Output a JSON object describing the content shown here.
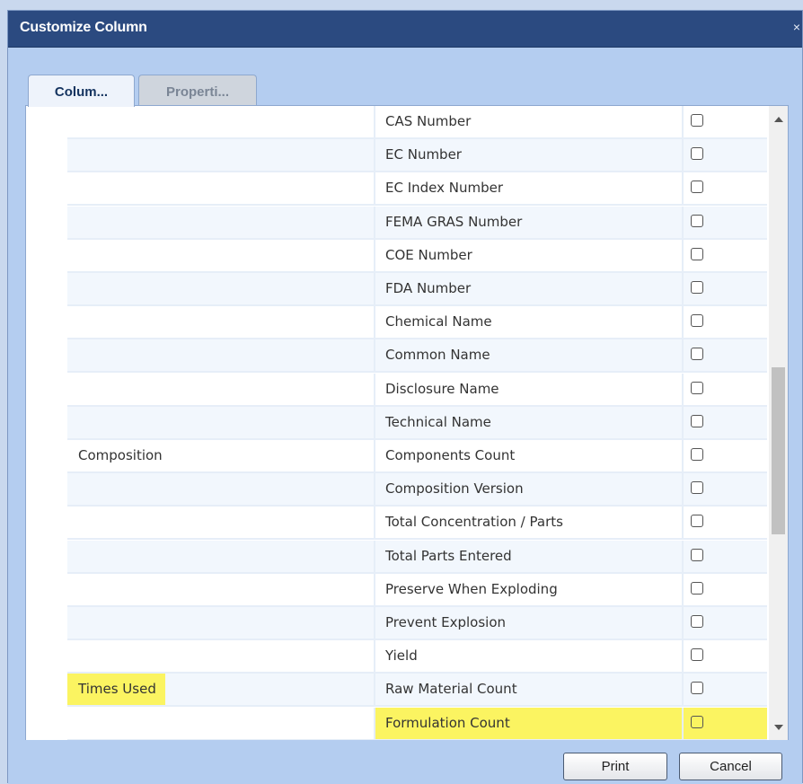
{
  "dialog": {
    "title": "Customize Column",
    "close_glyph": "×"
  },
  "tabs": [
    {
      "label": "Colum...",
      "active": true
    },
    {
      "label": "Properti...",
      "active": false
    }
  ],
  "rows": [
    {
      "group": "",
      "column": "CAS Number",
      "checked": false
    },
    {
      "group": "",
      "column": "EC Number",
      "checked": false
    },
    {
      "group": "",
      "column": "EC Index Number",
      "checked": false
    },
    {
      "group": "",
      "column": "FEMA GRAS Number",
      "checked": false
    },
    {
      "group": "",
      "column": "COE Number",
      "checked": false
    },
    {
      "group": "",
      "column": "FDA Number",
      "checked": false
    },
    {
      "group": "",
      "column": "Chemical Name",
      "checked": false
    },
    {
      "group": "",
      "column": "Common Name",
      "checked": false
    },
    {
      "group": "",
      "column": "Disclosure Name",
      "checked": false
    },
    {
      "group": "",
      "column": "Technical Name",
      "checked": false
    },
    {
      "group": "Composition",
      "column": "Components Count",
      "checked": false
    },
    {
      "group": "",
      "column": "Composition Version",
      "checked": false
    },
    {
      "group": "",
      "column": "Total Concentration / Parts",
      "checked": false
    },
    {
      "group": "",
      "column": "Total Parts Entered",
      "checked": false
    },
    {
      "group": "",
      "column": "Preserve When Exploding",
      "checked": false
    },
    {
      "group": "",
      "column": "Prevent Explosion",
      "checked": false
    },
    {
      "group": "",
      "column": "Yield",
      "checked": false
    },
    {
      "group": "Times Used",
      "column": "Raw Material Count",
      "checked": false,
      "group_highlight": true
    },
    {
      "group": "",
      "column": "Formulation Count",
      "checked": false,
      "column_highlight": true
    }
  ],
  "footer": {
    "print_label": "Print",
    "cancel_label": "Cancel"
  },
  "colors": {
    "title_bar": "#2b4a80",
    "dialog_bg": "#b4cdf0",
    "highlight": "#fbf461",
    "row_alt": "#f2f7fd"
  }
}
